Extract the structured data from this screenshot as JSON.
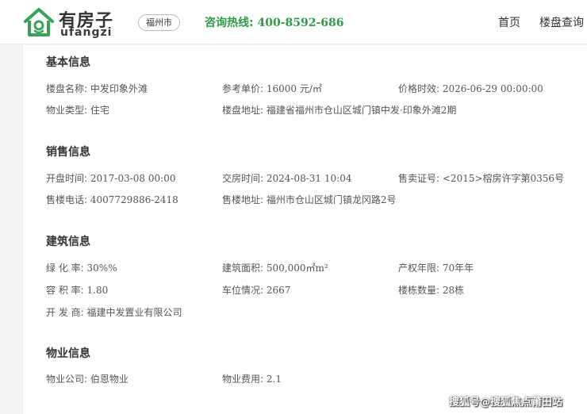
{
  "header": {
    "logo_cn": "有房子",
    "logo_en": "ufangzi",
    "city": "福州市",
    "hotline_label": "咨询热线:",
    "hotline_number": "400-8592-686",
    "nav": {
      "home": "首页",
      "search": "楼盘查询"
    },
    "brand_color": "#2e9b48"
  },
  "basic": {
    "title": "基本信息",
    "name_label": "楼盘名称:",
    "name_value": "中发印象外滩",
    "price_label": "参考单价:",
    "price_value": "16000 元/㎡",
    "validity_label": "价格时效:",
    "validity_value": "2026-06-29 00:00:00",
    "type_label": "物业类型:",
    "type_value": "住宅",
    "address_label": "楼盘地址:",
    "address_value": "福建省福州市仓山区城门镇中发·印象外滩2期"
  },
  "sales": {
    "title": "销售信息",
    "open_label": "开盘时间:",
    "open_value": "2017-03-08 00:00",
    "delivery_label": "交房时间:",
    "delivery_value": "2024-08-31 10:04",
    "permit_label": "售卖证号:",
    "permit_value": "<2015>榕房许字第0356号",
    "phone_label": "售楼电话:",
    "phone_value": "4007729886-2418",
    "office_label": "售楼地址:",
    "office_value": "福州市仓山区城门镇龙冈路2号"
  },
  "building": {
    "title": "建筑信息",
    "green_label": "绿 化 率:",
    "green_value": "30%%",
    "area_label": "建筑面积:",
    "area_value": "500,000㎡m²",
    "term_label": "产权年限:",
    "term_value": "70年年",
    "far_label": "容 积 率:",
    "far_value": "1.80",
    "parking_label": "车位情况:",
    "parking_value": "2667",
    "count_label": "楼栋数量:",
    "count_value": "28栋",
    "dev_label": "开 发 商:",
    "dev_value": "福建中发置业有限公司"
  },
  "property": {
    "title": "物业信息",
    "company_label": "物业公司:",
    "company_value": "伯恩物业",
    "fee_label": "物业费用:",
    "fee_value": "2.1"
  },
  "watermark": "搜狐号@搜狐焦点莆田站",
  "icons": {
    "logo": "house-icon"
  }
}
